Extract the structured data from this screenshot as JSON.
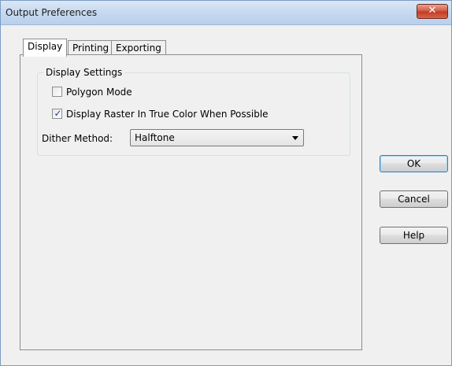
{
  "window": {
    "title": "Output Preferences",
    "close_glyph": "✕"
  },
  "tabs": [
    {
      "label": "Display",
      "active": true
    },
    {
      "label": "Printing",
      "active": false
    },
    {
      "label": "Exporting",
      "active": false
    }
  ],
  "display_settings": {
    "group_label": "Display Settings",
    "polygon_mode": {
      "label": "Polygon Mode",
      "checked": false
    },
    "true_color": {
      "label": "Display Raster In True Color When Possible",
      "checked": true
    },
    "dither": {
      "label": "Dither Method:",
      "value": "Halftone"
    }
  },
  "buttons": {
    "ok": "OK",
    "cancel": "Cancel",
    "help": "Help"
  },
  "icons": {
    "check_glyph": "✓"
  },
  "colors": {
    "titlebar": "#c8daf0",
    "close_button": "#c2391f",
    "dialog_bg": "#f0f0f0",
    "check_mark": "#1f3f8f"
  }
}
